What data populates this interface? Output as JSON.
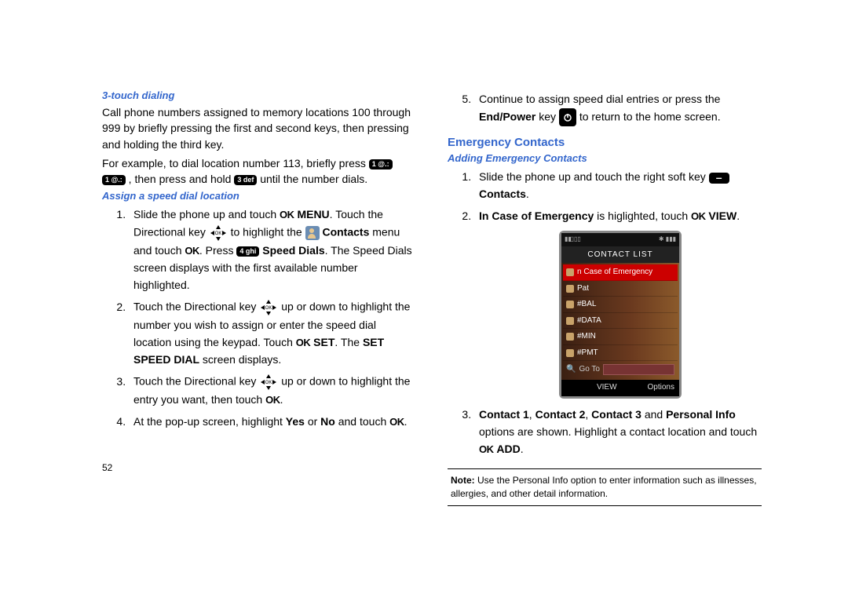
{
  "page_number": "52",
  "left": {
    "sub1_title": "3-touch dialing",
    "sub1_para1": "Call phone numbers assigned to memory locations 100 through 999 by briefly pressing the first and second keys, then pressing and holding the third key.",
    "sub1_para2_a": "For example, to dial location number 113, briefly press ",
    "sub1_para2_b": ", then press and hold ",
    "sub1_para2_c": " until the number dials.",
    "key_1": "1 @.:",
    "key_3def": "3 def",
    "sub2_title": "Assign a speed dial location",
    "s1_a": "Slide the phone up and touch ",
    "s1_b": " MENU",
    "s1_c": ". Touch the Directional key ",
    "s1_d": " to highlight the ",
    "s1_e": " Contacts",
    "s1_f": " menu and touch ",
    "s1_g": ". Press ",
    "key_4ghi": "4 ghi",
    "s1_h": " Speed Dials",
    "s1_i": ". The Speed Dials screen displays with the first available number highlighted.",
    "s2_a": "Touch the Directional key ",
    "s2_b": " up or down to highlight the number you wish to assign or enter the speed dial location using the keypad. Touch ",
    "s2_c": " SET",
    "s2_d": ". The ",
    "s2_e": "SET SPEED DIAL",
    "s2_f": " screen displays.",
    "s3_a": "Touch the Directional key ",
    "s3_b": " up or down to highlight the entry you want, then touch ",
    "s3_c": ".",
    "s4_a": "At the pop-up screen, highlight ",
    "s4_yes": "Yes",
    "s4_or": " or ",
    "s4_no": "No",
    "s4_b": " and touch ",
    "s4_c": "."
  },
  "right": {
    "s5_a": "Continue to assign speed dial entries or press the ",
    "s5_b": "End/Power",
    "s5_c": " key ",
    "s5_d": " to return to the home screen.",
    "section_title": "Emergency Contacts",
    "sub_title": "Adding Emergency Contacts",
    "e1_a": "Slide the phone up and touch the right soft key ",
    "e1_b": " Contacts",
    "e1_c": ".",
    "e2_a": "In Case of Emergency",
    "e2_b": " is higlighted, touch ",
    "e2_c": " VIEW",
    "e2_d": ".",
    "e3_a": "Contact 1",
    "e3_b": ", ",
    "e3_c": "Contact 2",
    "e3_d": ", ",
    "e3_e": "Contact 3",
    "e3_f": " and ",
    "e3_g": "Personal Info",
    "e3_h": " options are shown. Highlight a contact location and touch ",
    "e3_i": " ADD",
    "e3_j": ".",
    "note_label": "Note:",
    "note_text": " Use the Personal Info option to enter information such as illnesses, allergies, and other detail information.",
    "phone": {
      "title": "CONTACT LIST",
      "items": [
        "n Case of Emergency",
        "Pat",
        "#BAL",
        "#DATA",
        "#MIN",
        "#PMT"
      ],
      "goto": "Go To",
      "soft_center": "VIEW",
      "soft_right": "Options"
    }
  }
}
